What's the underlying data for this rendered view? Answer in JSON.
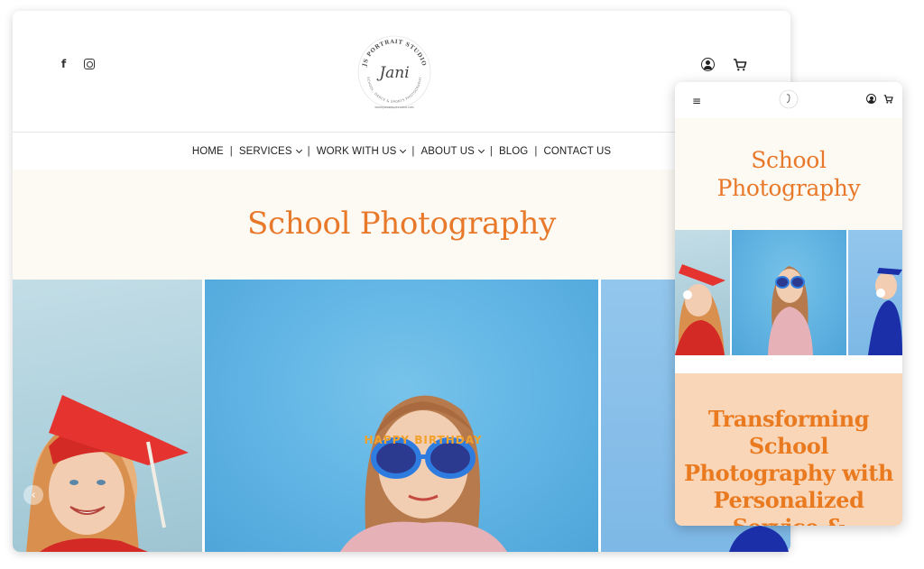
{
  "desktop": {
    "header": {
      "social": [
        "facebook-icon",
        "instagram-icon"
      ],
      "logo": {
        "brand_arc": "JS PORTRAIT STUDIO",
        "script": "Jani",
        "tagline_arc": "SCHOOL, DANCE & SPORTS PHOTOGRAPHY",
        "url": "WWW.JSPORTRAITSTUDIO.COM"
      },
      "icons": [
        "user-icon",
        "cart-icon"
      ]
    },
    "nav": {
      "items": [
        {
          "label": "HOME",
          "dropdown": false
        },
        {
          "label": "SERVICES",
          "dropdown": true
        },
        {
          "label": "WORK WITH US",
          "dropdown": true
        },
        {
          "label": "ABOUT US",
          "dropdown": true
        },
        {
          "label": "BLOG",
          "dropdown": false
        },
        {
          "label": "CONTACT US",
          "dropdown": false
        }
      ],
      "separator": "|"
    },
    "hero": {
      "title": "School Photography"
    },
    "slider": {
      "prev_arrow": "‹"
    },
    "photos": {
      "p2_glasses_text": "HAPPY BIRTHDAY"
    }
  },
  "mobile": {
    "menu_icon": "≡",
    "hero": {
      "title_line1": "School",
      "title_line2": "Photography"
    },
    "panel": {
      "lines": [
        "Transforming",
        "School",
        "Photography with",
        "Personalized",
        "Service &"
      ]
    }
  },
  "colors": {
    "accent_orange": "#e8782a",
    "hero_bg": "#fcfaf3",
    "panel_bg": "#fad6b8",
    "photo_blue": "#5fb4e4"
  }
}
